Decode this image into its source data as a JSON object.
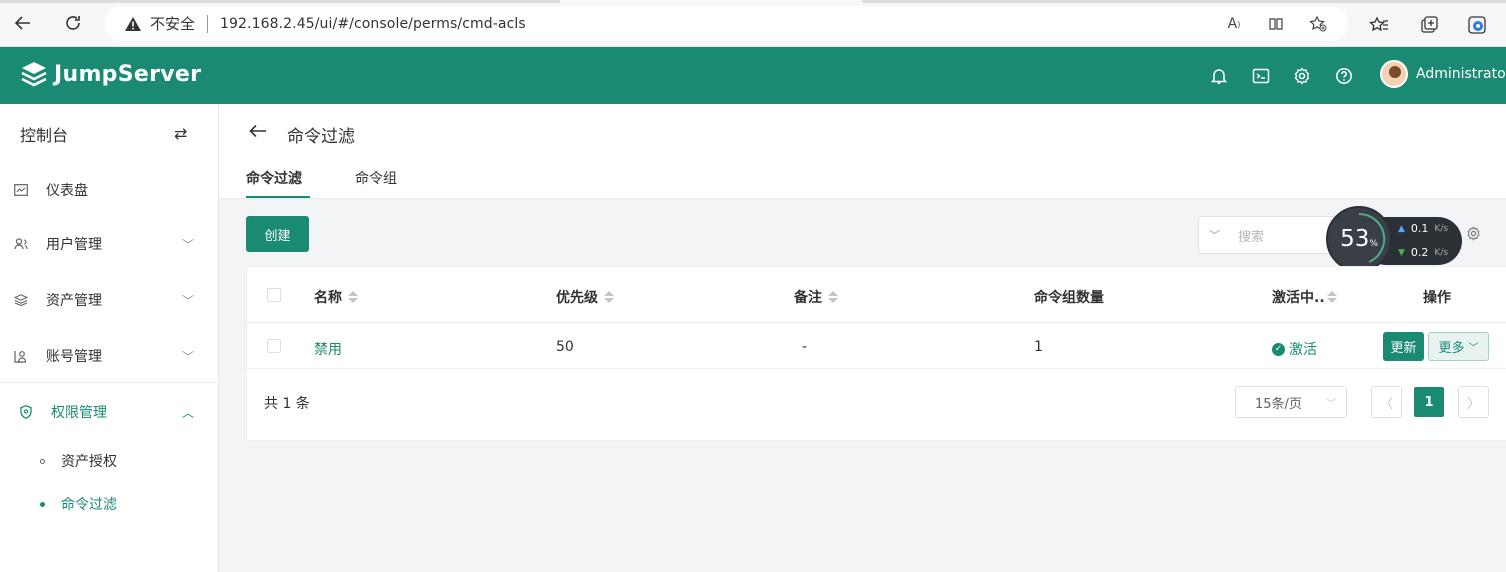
{
  "browser": {
    "insecure_label": "不安全",
    "url": "192.168.2.45/ui/#/console/perms/cmd-acls"
  },
  "header": {
    "brand": "JumpServer",
    "username": "Administrator",
    "accent_color": "#1a8a72"
  },
  "sidebar": {
    "title": "控制台",
    "items": [
      {
        "label": "仪表盘",
        "icon": "dashboard-icon"
      },
      {
        "label": "用户管理",
        "icon": "users-icon"
      },
      {
        "label": "资产管理",
        "icon": "assets-icon"
      },
      {
        "label": "账号管理",
        "icon": "accounts-icon"
      },
      {
        "label": "权限管理",
        "icon": "shield-icon"
      }
    ],
    "sub_items": [
      {
        "label": "资产授权"
      },
      {
        "label": "命令过滤"
      }
    ]
  },
  "page": {
    "title": "命令过滤",
    "tabs": [
      {
        "label": "命令过滤"
      },
      {
        "label": "命令组"
      }
    ]
  },
  "toolbar": {
    "create_label": "创建",
    "search_placeholder": "搜索"
  },
  "net_widget": {
    "percent": "53",
    "percent_unit": "%",
    "upload": "0.1",
    "download": "0.2",
    "unit": "K/s"
  },
  "table": {
    "columns": [
      "名称",
      "优先级",
      "备注",
      "命令组数量",
      "激活中..",
      "操作"
    ],
    "rows": [
      {
        "name": "禁用",
        "priority": "50",
        "comment": "-",
        "group_count": "1",
        "status": "激活",
        "update_label": "更新",
        "more_label": "更多"
      }
    ]
  },
  "pagination": {
    "total": "共 1 条",
    "page_size": "15条/页",
    "current_page": "1"
  }
}
